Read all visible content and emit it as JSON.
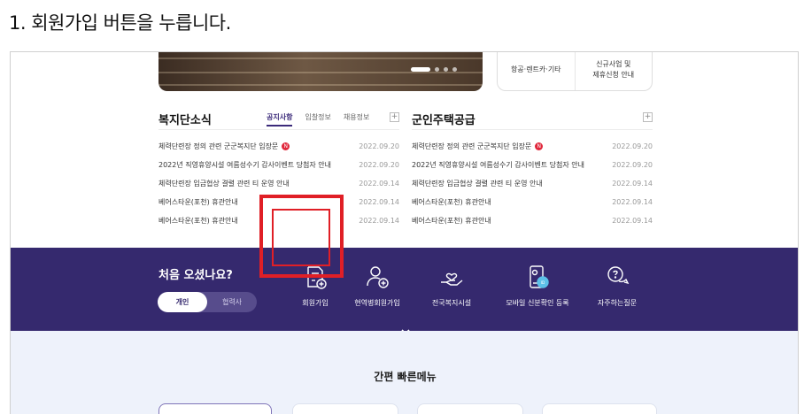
{
  "step": {
    "title": "1. 회원가입 버튼을 누릅니다."
  },
  "banner": {
    "dots_count": 4,
    "active_dot": 1
  },
  "quick_box": {
    "cells": [
      {
        "lines": [
          "항공·렌트카·기타"
        ]
      },
      {
        "lines": [
          "신규사업 및",
          "제휴신청 안내"
        ]
      }
    ]
  },
  "welfare_news": {
    "title": "복지단소식",
    "tabs": [
      "공지사항",
      "입찰정보",
      "채용정보"
    ],
    "active_tab": 0,
    "plus": "+",
    "items": [
      {
        "text": "체력단련장 정의 관련 군군복지단 입장문",
        "badge": "N",
        "date": "2022.09.20"
      },
      {
        "text": "2022년 직영휴양시설 여름성수기 감사이벤트 당첨자 안내",
        "badge": "",
        "date": "2022.09.20"
      },
      {
        "text": "체력단련장 입금협상 결렬 관련 티 운영 안내",
        "badge": "",
        "date": "2022.09.14"
      },
      {
        "text": "베어스타운(포천) 휴관안내",
        "badge": "",
        "date": "2022.09.14"
      },
      {
        "text": "베어스타운(포천) 휴관안내",
        "badge": "",
        "date": "2022.09.14"
      }
    ]
  },
  "housing_news": {
    "title": "군인주택공급",
    "plus": "+",
    "items": [
      {
        "text": "체력단련장 정의 관련 군군복지단 입장문",
        "badge": "N",
        "date": "2022.09.20"
      },
      {
        "text": "2022년 직영휴양시설 여름성수기 감사이벤트 당첨자 안내",
        "badge": "",
        "date": "2022.09.20"
      },
      {
        "text": "체력단련장 입금협상 결렬 관련 티 운영 안내",
        "badge": "",
        "date": "2022.09.14"
      },
      {
        "text": "베어스타운(포천) 휴관안내",
        "badge": "",
        "date": "2022.09.14"
      },
      {
        "text": "베어스타운(포천) 휴관안내",
        "badge": "",
        "date": "2022.09.14"
      }
    ]
  },
  "band": {
    "first_visit": "처음 오셨나요?",
    "toggle": {
      "options": [
        "개인",
        "협력사"
      ],
      "selected": "개인"
    },
    "services": [
      {
        "label": "회원가입",
        "icon": "document-plus-icon",
        "highlighted": true
      },
      {
        "label": "현역병회원가입",
        "icon": "user-plus-icon",
        "highlighted": false
      },
      {
        "label": "전국복지시설",
        "icon": "hand-heart-icon",
        "highlighted": false
      },
      {
        "label": "모바일 신분확인 등록",
        "icon": "mobile-id-icon",
        "highlighted": false
      },
      {
        "label": "자주하는질문",
        "icon": "question-chat-icon",
        "highlighted": false
      }
    ],
    "highlight_color": "#e01f26",
    "background": "#35296e"
  },
  "bottom": {
    "title": "간편 빠른메뉴"
  }
}
